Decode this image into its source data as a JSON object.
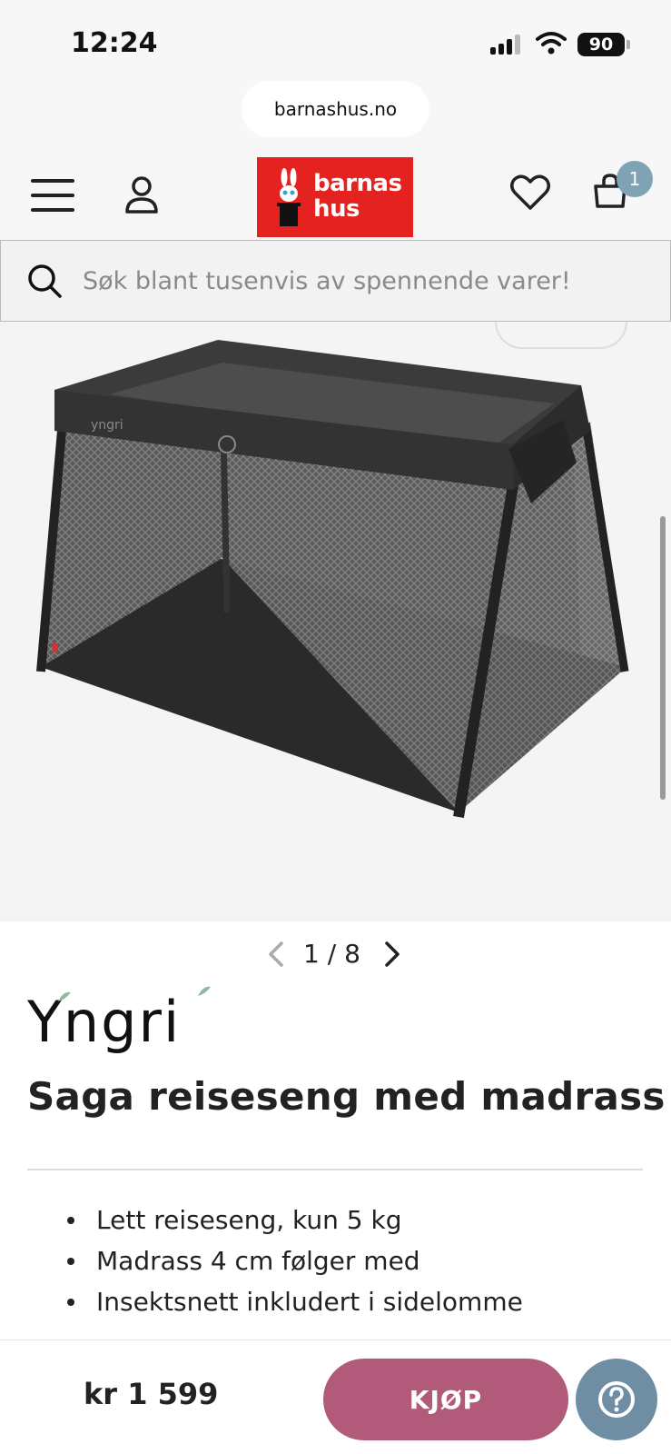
{
  "status_bar": {
    "time": "12:24",
    "battery": "90"
  },
  "browser": {
    "url": "barnashus.no"
  },
  "header": {
    "logo_line1": "barnas",
    "logo_line2": "hus",
    "cart_count": "1",
    "icons": [
      "menu-icon",
      "user-icon",
      "heart-icon",
      "cart-icon"
    ]
  },
  "search": {
    "placeholder": "Søk blant tusenvis av spennende varer!"
  },
  "gallery": {
    "current": "1",
    "separator": "/",
    "total": "8"
  },
  "product": {
    "brand": "Yngri",
    "title": "Saga reiseseng med madrass",
    "features": [
      "Lett reiseseng, kun 5 kg",
      "Madrass 4 cm følger med",
      "Insektsnett inkludert i sidelomme"
    ]
  },
  "bottom_bar": {
    "price": "kr 1 599",
    "buy_label": "KJØP"
  },
  "colors": {
    "brand_red": "#e4221f",
    "buy_button": "#b25a79",
    "help_button": "#6f8ea3",
    "cart_badge": "#7fa3b4"
  }
}
